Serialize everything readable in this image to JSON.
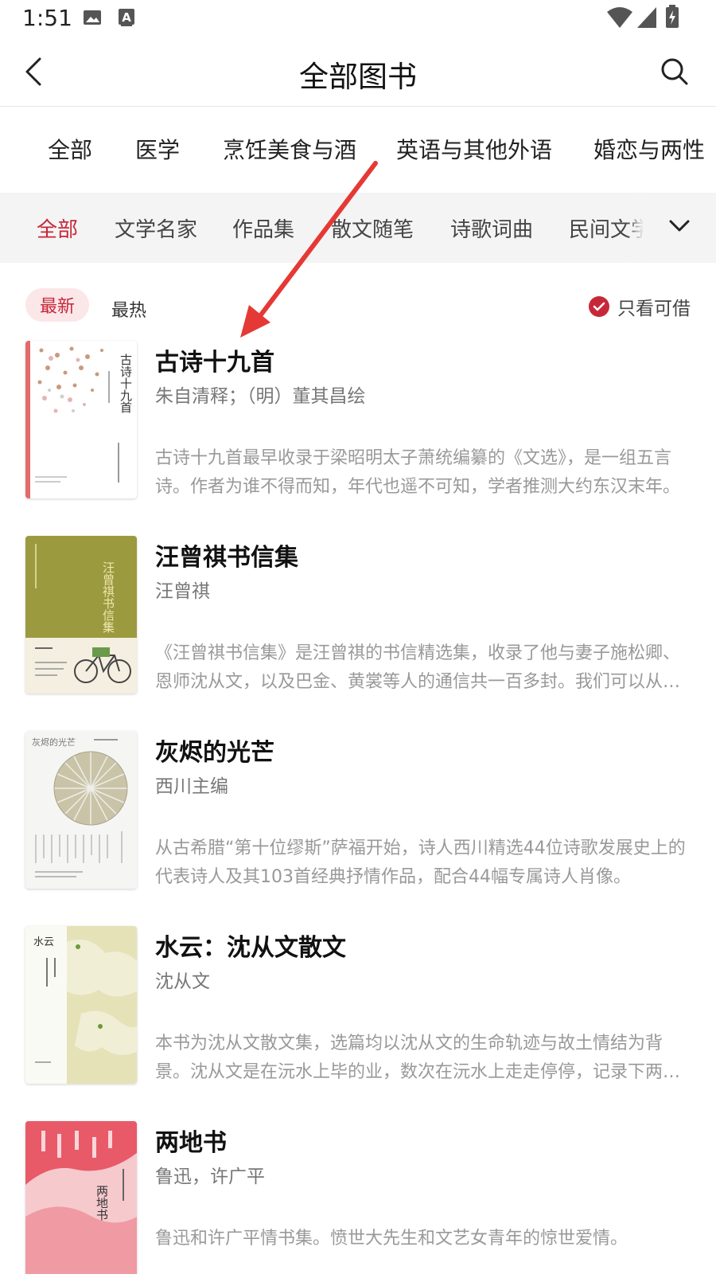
{
  "status_bar": {
    "time": "1:51",
    "icons": [
      "image-icon",
      "a-notification-icon",
      "wifi-icon",
      "cell-signal-icon",
      "battery-charging-icon"
    ]
  },
  "header": {
    "title": "全部图书",
    "back_icon": "chevron-left-icon",
    "search_icon": "search-icon"
  },
  "category_tabs": [
    {
      "label": "全部"
    },
    {
      "label": "医学"
    },
    {
      "label": "烹饪美食与酒"
    },
    {
      "label": "英语与其他外语"
    },
    {
      "label": "婚恋与两性"
    }
  ],
  "subcategory_tabs": [
    {
      "label": "全部",
      "active": true
    },
    {
      "label": "文学名家",
      "active": false
    },
    {
      "label": "作品集",
      "active": false
    },
    {
      "label": "散文随笔",
      "active": false
    },
    {
      "label": "诗歌词曲",
      "active": false
    },
    {
      "label": "民间文学",
      "active": false
    }
  ],
  "filters": {
    "newest": "最新",
    "hottest": "最热",
    "only_available": "只看可借",
    "only_available_checked": true
  },
  "books": [
    {
      "title": "古诗十九首",
      "author": "朱自清释；（明）董其昌绘",
      "description": "古诗十九首最早收录于梁昭明太子萧统编纂的《文选》，是一组五言诗。作者为谁不得而知，年代也遥不可知，学者推测大约东汉末年。",
      "cover_text": "古诗十九首"
    },
    {
      "title": "汪曾祺书信集",
      "author": "汪曾祺",
      "description": "《汪曾祺书信集》是汪曾祺的书信精选集，收录了他与妻子施松卿、恩师沈从文，以及巴金、黄裳等人的通信共一百多封。我们可以从中看到他的生活。",
      "cover_text": "汪曾祺书信集"
    },
    {
      "title": "灰烬的光芒",
      "author": "西川主编",
      "description": "从古希腊“第十位缪斯”萨福开始，诗人西川精选44位诗歌发展史上的代表诗人及其103首经典抒情作品，配合44幅专属诗人肖像。",
      "cover_text": "灰烬的光芒"
    },
    {
      "title": "水云：沈从文散文",
      "author": "沈从文",
      "description": "本书为沈从文散文集，选篇均以沈从文的生命轨迹与故土情结为背景。沈从文是在沅水上毕的业，数次在沅水上走走停停，记录下两岸风景。",
      "cover_text": "水云"
    },
    {
      "title": "两地书",
      "author": "鲁迅，许广平",
      "description": "鲁迅和许广平情书集。愤世大先生和文艺女青年的惊世爱情。",
      "cover_text": "两地书"
    }
  ],
  "colors": {
    "accent": "#c6283a",
    "accent_bg": "#fbe6e8",
    "subtab_bg": "#f4f4f4",
    "annotation_arrow": "#e53935"
  }
}
